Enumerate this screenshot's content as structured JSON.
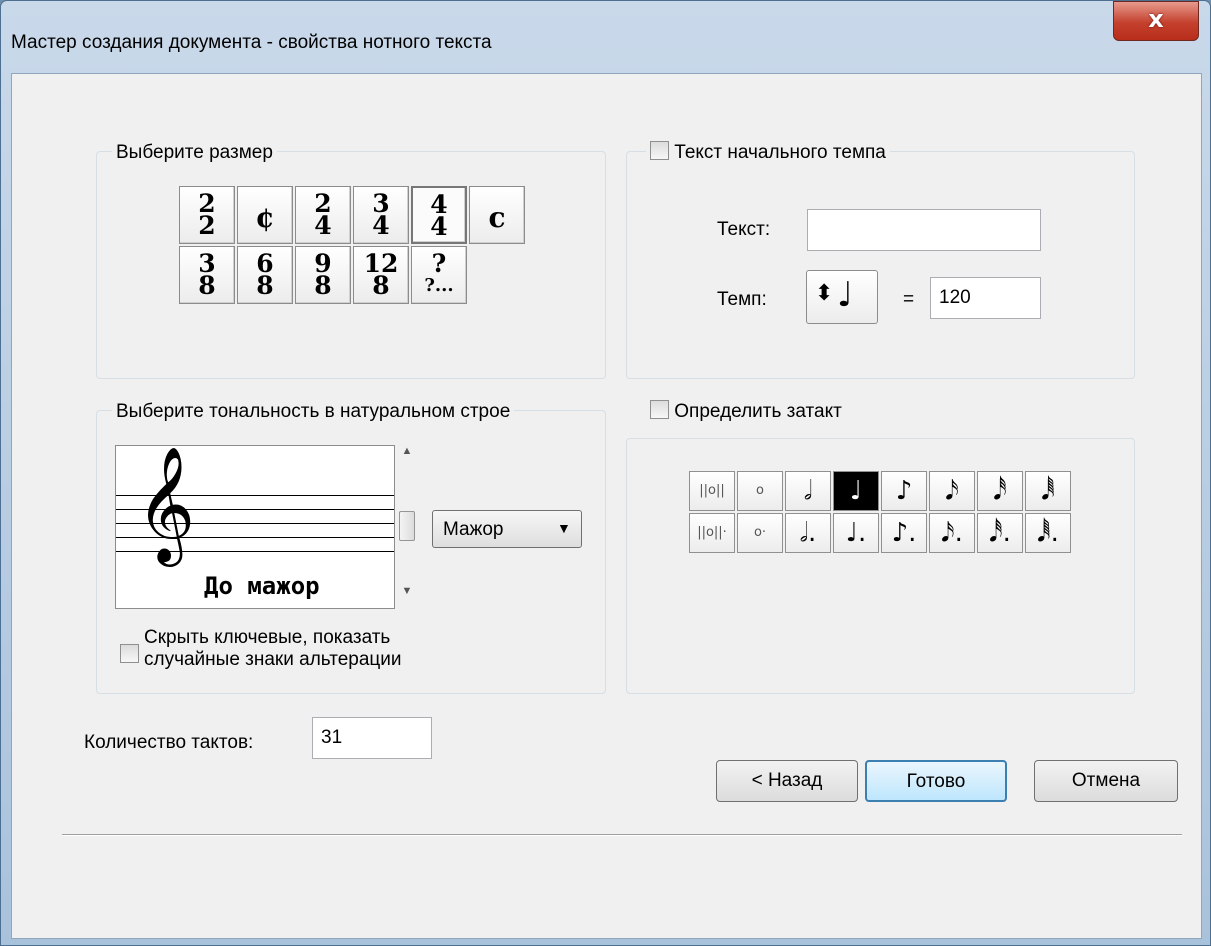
{
  "window": {
    "title": "Мастер создания документа - свойства нотного текста",
    "close_label": "x"
  },
  "time_signature": {
    "label": "Выберите размер",
    "row1": [
      {
        "top": "2",
        "bottom": "2"
      },
      {
        "single": "¢"
      },
      {
        "top": "2",
        "bottom": "4"
      },
      {
        "top": "3",
        "bottom": "4"
      },
      {
        "top": "4",
        "bottom": "4"
      },
      {
        "single": "c"
      }
    ],
    "row2": [
      {
        "top": "3",
        "bottom": "8"
      },
      {
        "top": "6",
        "bottom": "8"
      },
      {
        "top": "9",
        "bottom": "8"
      },
      {
        "top": "12",
        "bottom": "8"
      },
      {
        "top": "?",
        "bottom": "?..."
      }
    ],
    "selected": "4/4"
  },
  "tempo": {
    "checkbox_label": "Текст начального темпа",
    "text_label": "Текст:",
    "text_value": "",
    "tempo_label": "Темп:",
    "note_glyph": "♩",
    "spinner_glyph": "⬍",
    "equals": "=",
    "tempo_value": "120"
  },
  "key": {
    "label": "Выберите тональность в натуральном строе",
    "clef_glyph": "𝄞",
    "key_name": "До мажор",
    "mode_value": "Мажор",
    "hide_checkbox_line1": "Скрыть ключевые, показать",
    "hide_checkbox_line2": "случайные знаки альтерации"
  },
  "pickup": {
    "checkbox_label": "Определить затакт",
    "row1": [
      "||o||",
      "o",
      "𝅗𝅥",
      "♩",
      "♪",
      "𝅘𝅥𝅯",
      "𝅘𝅥𝅰",
      "𝅘𝅥𝅱"
    ],
    "row2": [
      "||o||·",
      "o·",
      "𝅗𝅥.",
      "♩.",
      "♪.",
      "𝅘𝅥𝅯.",
      "𝅘𝅥𝅰.",
      "𝅘𝅥𝅱."
    ],
    "selected_index": 3
  },
  "measures": {
    "label": "Количество тактов:",
    "value": "31"
  },
  "buttons": {
    "back": "< Назад",
    "finish": "Готово",
    "cancel": "Отмена"
  }
}
